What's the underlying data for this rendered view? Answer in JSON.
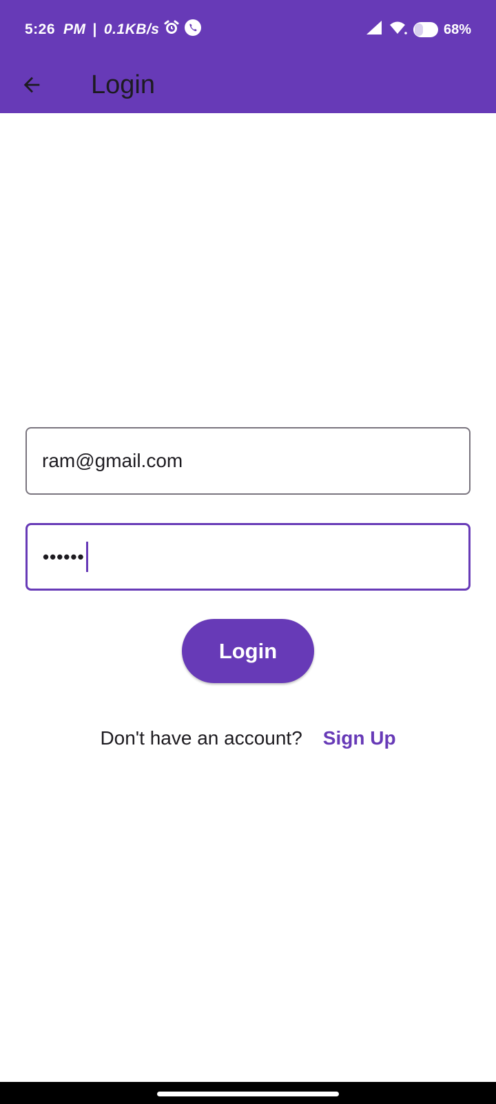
{
  "status_bar": {
    "time": "5:26",
    "ampm": "PM",
    "separator": "|",
    "net_speed": "0.1KB/s",
    "battery_percent": "68%",
    "icons": [
      "alarm-icon",
      "phone-call-icon",
      "signal-icon",
      "wifi-icon",
      "battery-icon"
    ]
  },
  "app_bar": {
    "title": "Login",
    "back_icon": "arrow-back-icon"
  },
  "form": {
    "email_value": "ram@gmail.com",
    "password_value": "••••••",
    "login_label": "Login"
  },
  "signup": {
    "prompt": "Don't have an account?",
    "link_label": "Sign Up"
  },
  "colors": {
    "primary": "#673ab7",
    "text": "#1d1b20",
    "outline": "#79747e",
    "background": "#ffffff"
  }
}
